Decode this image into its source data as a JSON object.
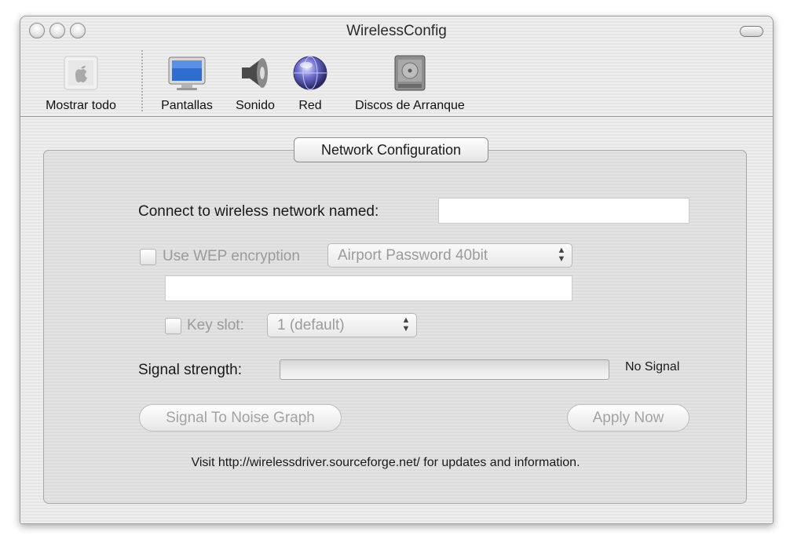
{
  "window": {
    "title": "WirelessConfig"
  },
  "toolbar": {
    "items": [
      {
        "label": "Mostrar todo",
        "icon": "apple-icon"
      },
      {
        "label": "Pantallas",
        "icon": "display-icon"
      },
      {
        "label": "Sonido",
        "icon": "speaker-icon"
      },
      {
        "label": "Red",
        "icon": "globe-icon"
      },
      {
        "label": "Discos de Arranque",
        "icon": "hard-disk-icon"
      }
    ]
  },
  "panel": {
    "title": "Network Configuration",
    "network_label": "Connect to wireless network named:",
    "network_value": "",
    "wep_label": "Use WEP encryption",
    "wep_checked": false,
    "wep_type": "Airport Password 40bit",
    "wep_key_value": "",
    "key_slot_label": "Key slot:",
    "key_slot_checked": false,
    "key_slot_value": "1 (default)",
    "signal_label": "Signal strength:",
    "signal_level": 0,
    "signal_status": "No Signal",
    "graph_button": "Signal To Noise Graph",
    "apply_button": "Apply Now",
    "footer_text": "Visit http://wirelessdriver.sourceforge.net/ for updates and information."
  },
  "colors": {
    "accent": "#6d98d4",
    "disabled_text": "#9b9b9b"
  }
}
